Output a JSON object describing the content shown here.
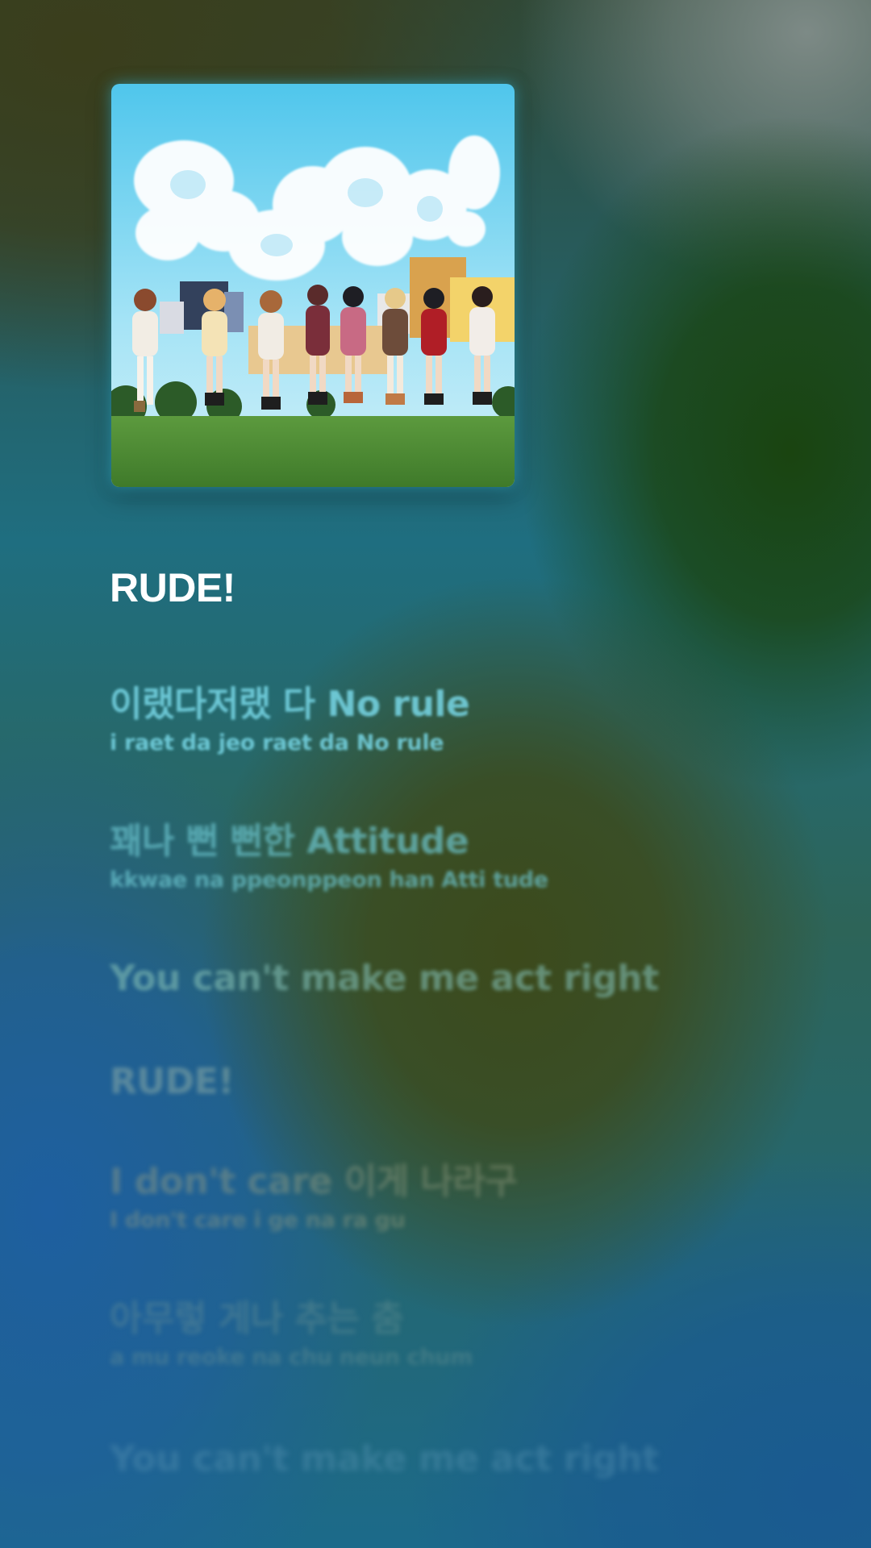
{
  "song": {
    "title": "RUDE!",
    "album_art_icon": "album-cover-image"
  },
  "lyrics": [
    {
      "main": "이랬다저랬   다 No rule",
      "roman": "i raet da jeo raet da  No    rule"
    },
    {
      "main": "꽤나     뻔     뻔한       Attitude",
      "roman": "kkwae na ppeonppeon han Atti    tude"
    },
    {
      "main": "You can't make me act right",
      "roman": ""
    },
    {
      "main": "RUDE!",
      "roman": ""
    },
    {
      "main": "I don't care 이게 나라구",
      "roman": "I don't       care      i ge     na ra gu"
    },
    {
      "main": "아무렇 게나 추는      춤",
      "roman": "a mu reoke na  chu neun chum"
    },
    {
      "main": "You can't make me act right",
      "roman": ""
    }
  ],
  "colors": {
    "title": "#ffffff",
    "active_lyric": "#78d7e6",
    "album_glow": "#3cc8e6"
  }
}
